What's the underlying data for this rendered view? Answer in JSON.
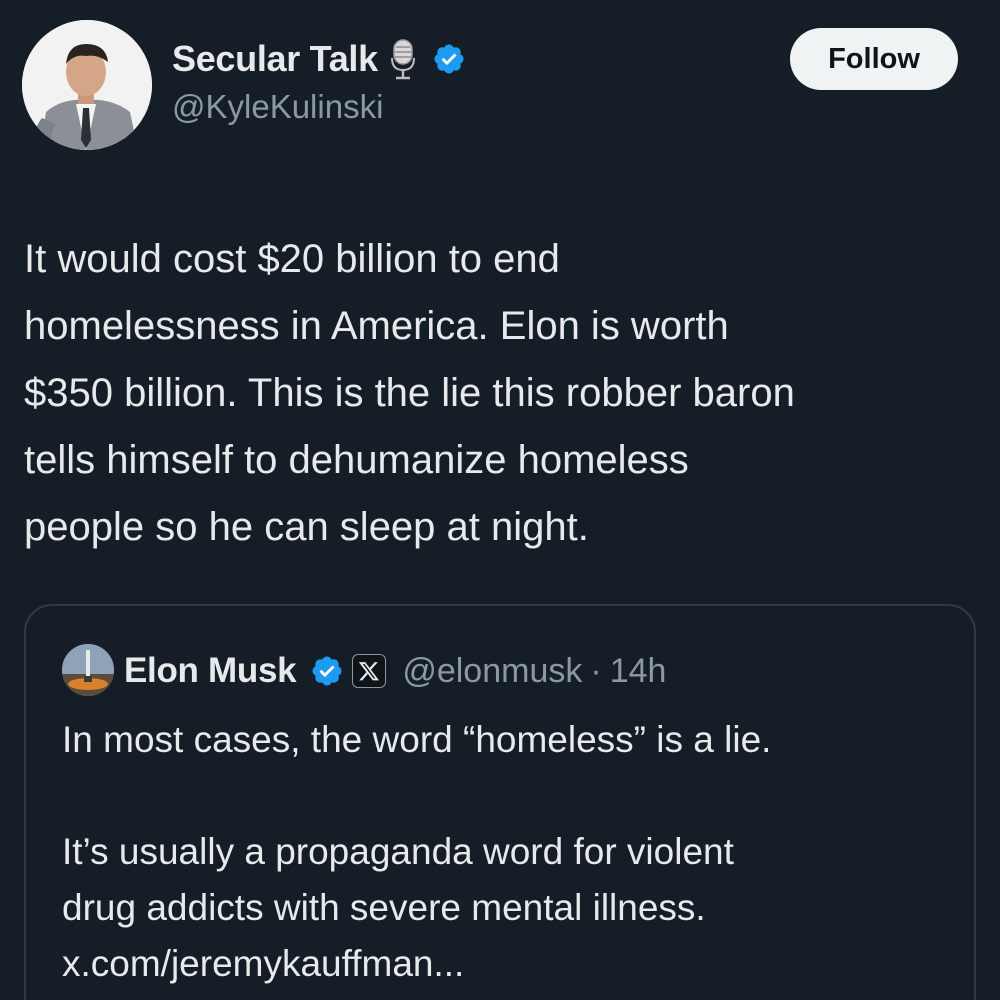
{
  "author": {
    "display_name": "Secular Talk",
    "handle": "@KyleKulinski",
    "badge_icon": "microphone-icon",
    "verified_icon": "verified-badge-icon"
  },
  "follow_label": "Follow",
  "post": {
    "text": "It would cost $20 billion to end\nhomelessness in America. Elon is worth\n$350 billion. This is the lie this robber baron\ntells himself to dehumanize homeless\npeople so he can sleep at night."
  },
  "quote": {
    "display_name": "Elon Musk",
    "handle": "@elonmusk",
    "separator": "·",
    "time": "14h",
    "affiliate_icon": "x-logo-icon",
    "paragraph1": "In most cases, the word “homeless” is a lie.",
    "paragraph2_line1": "It’s usually a propaganda word for violent",
    "paragraph2_line2": "drug addicts with severe mental illness.",
    "link": "x.com/jeremykauffman..."
  },
  "colors": {
    "background": "#151d27",
    "text": "#e7e9ea",
    "muted": "#8b98a5",
    "verified": "#1d9bf0",
    "border": "#2f3b47"
  }
}
